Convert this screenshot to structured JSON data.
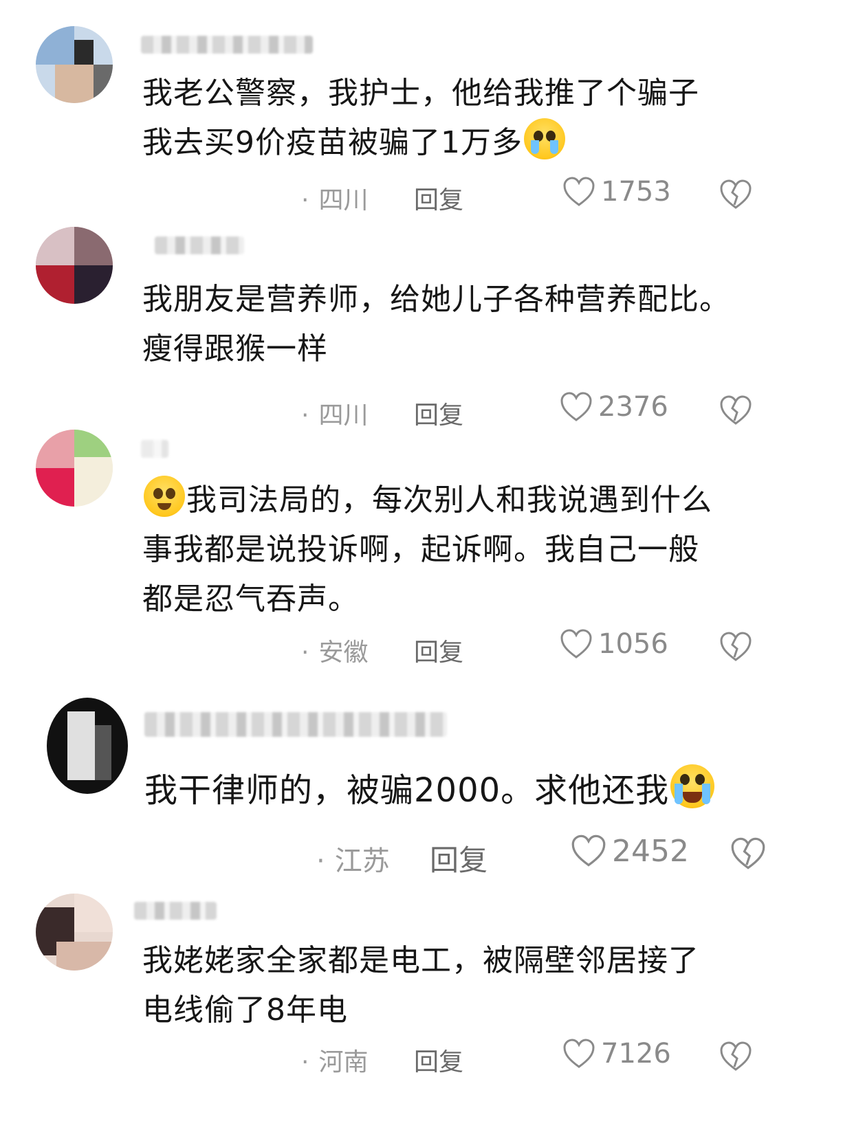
{
  "comments": [
    {
      "text_lines": [
        "我老公警察，我护士，他给我推了个骗子",
        "我去买9价疫苗被骗了1万多"
      ],
      "location": "四川",
      "reply": "回复",
      "likes": "1753",
      "emoji": "pleading-face"
    },
    {
      "text_lines": [
        "我朋友是营养师，给她儿子各种营养配比。",
        "瘦得跟猴一样"
      ],
      "location": "四川",
      "reply": "回复",
      "likes": "2376"
    },
    {
      "text_lines": [
        "我司法局的，每次别人和我说遇到什么",
        "事我都是说投诉啊，起诉啊。我自己一般",
        "都是忍气吞声。"
      ],
      "location": "安徽",
      "reply": "回复",
      "likes": "1056",
      "emoji": "smile-face"
    },
    {
      "text_lines": [
        "我干律师的，被骗2000。求他还我"
      ],
      "location": "江苏",
      "reply": "回复",
      "likes": "2452",
      "emoji": "crying-face"
    },
    {
      "text_lines": [
        "我姥姥家全家都是电工，被隔壁邻居接了",
        "电线偷了8年电"
      ],
      "location": "河南",
      "reply": "回复",
      "likes": "7126"
    }
  ],
  "dot": "·"
}
